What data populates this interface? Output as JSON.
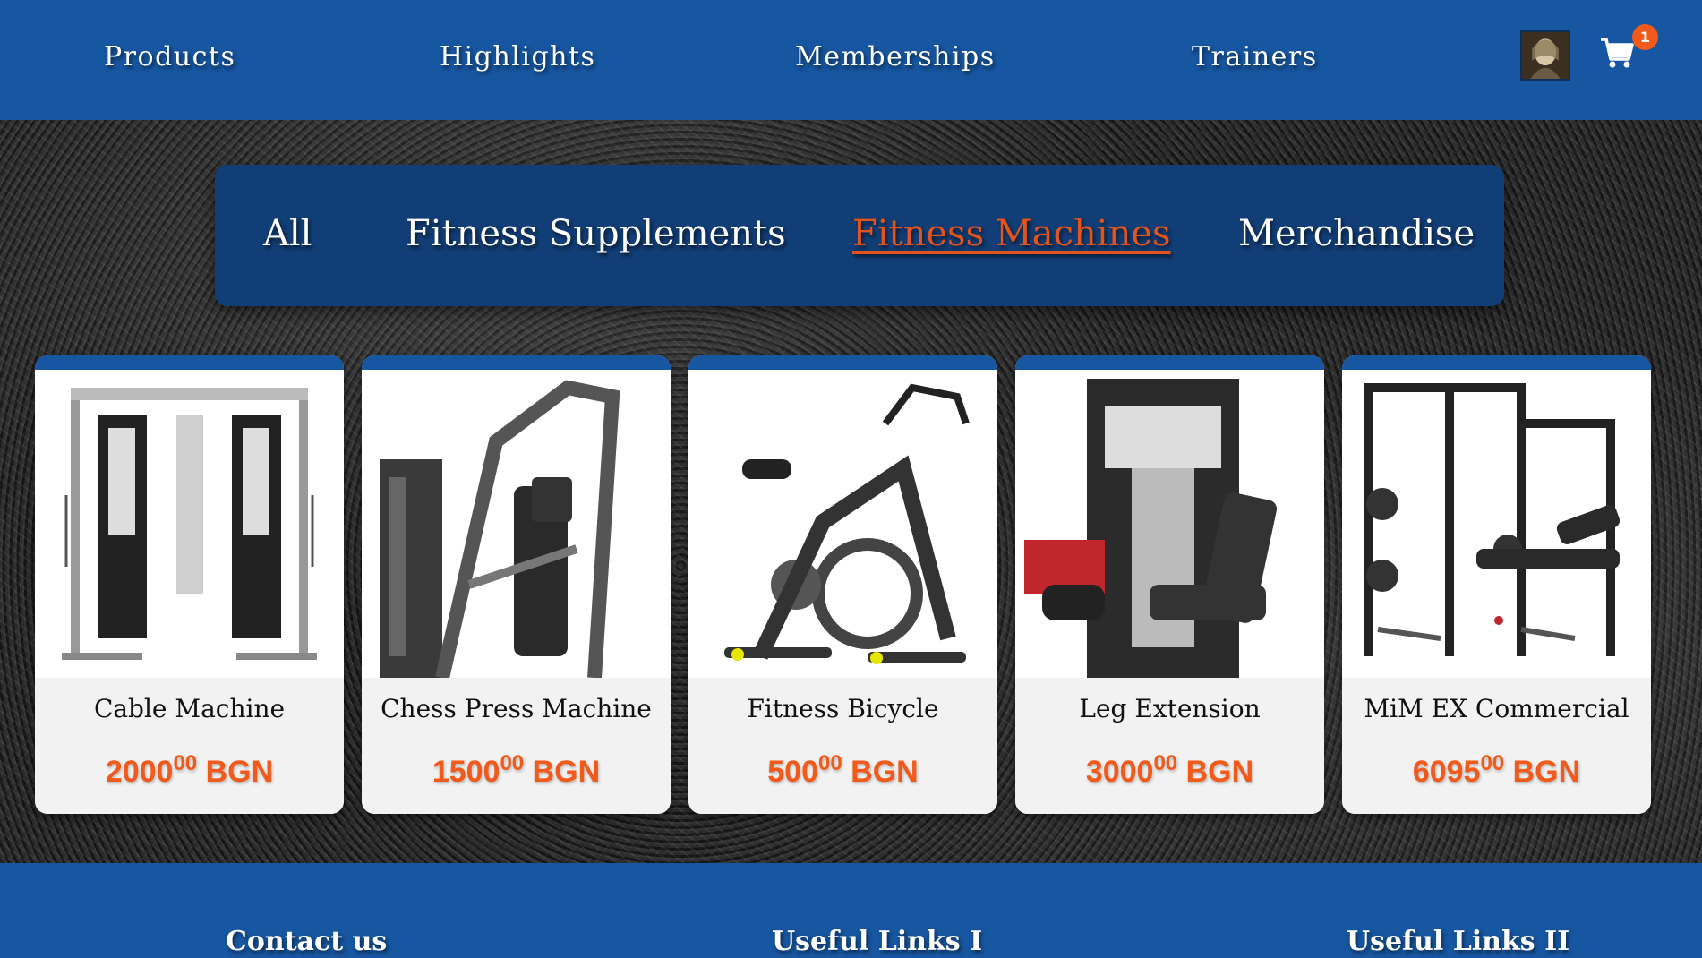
{
  "nav": {
    "links": [
      "Products",
      "Highlights",
      "Memberships",
      "Trainers"
    ],
    "cart_count": "1",
    "avatar_icon": "user-avatar",
    "cart_icon": "shopping-cart-icon"
  },
  "categories": {
    "items": [
      "All",
      "Fitness Supplements",
      "Fitness Machines",
      "Merchandise"
    ],
    "active": "Fitness Machines",
    "active_color": "#e2541b"
  },
  "products": [
    {
      "name": "Cable Machine",
      "price_int": "2000",
      "price_dec": "00",
      "currency": "BGN",
      "image": "cable-machine-image"
    },
    {
      "name": "Chess Press Machine",
      "price_int": "1500",
      "price_dec": "00",
      "currency": "BGN",
      "image": "chest-press-machine-image"
    },
    {
      "name": "Fitness Bicycle",
      "price_int": "500",
      "price_dec": "00",
      "currency": "BGN",
      "image": "fitness-bicycle-image"
    },
    {
      "name": "Leg Extension",
      "price_int": "3000",
      "price_dec": "00",
      "currency": "BGN",
      "image": "leg-extension-image"
    },
    {
      "name": "MiM EX Commercial",
      "price_int": "6095",
      "price_dec": "00",
      "currency": "BGN",
      "image": "multi-gym-image"
    }
  ],
  "footer": {
    "headings": [
      "Contact us",
      "Useful Links I",
      "Useful Links II"
    ]
  },
  "colors": {
    "brand_blue": "#1756a0",
    "panel_blue": "#123e77",
    "price_orange": "#f15a1a"
  }
}
